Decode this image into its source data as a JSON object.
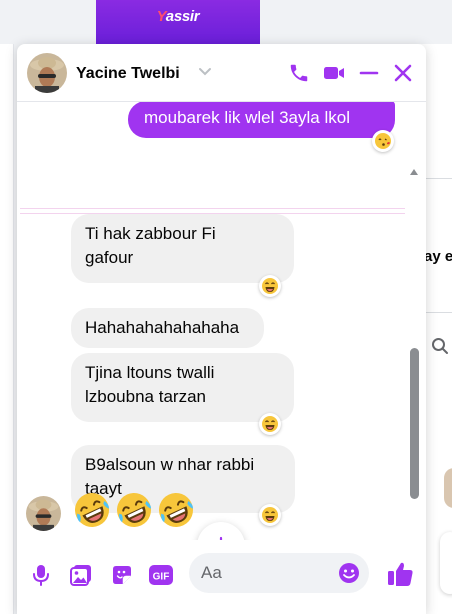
{
  "background": {
    "banner_brand": "assir",
    "banner_brand_initial": "Y",
    "side_text": "ay e"
  },
  "header": {
    "contact_name": "Yacine Twelbi"
  },
  "messages": [
    {
      "id": "m1",
      "direction": "out",
      "text": "moubarek lik wlel 3ayla lkol",
      "reaction": "kiss-emoji"
    },
    {
      "id": "m2",
      "direction": "in",
      "text": "Ti hak zabbour Fi gafour",
      "line1": "Ti hak zabbour Fi",
      "line2": "gafour",
      "reaction": "laugh-emoji"
    },
    {
      "id": "m3",
      "direction": "in",
      "text": "Hahahahahahahaha"
    },
    {
      "id": "m4",
      "direction": "in",
      "text": "Tjina ltouns twalli lzboubna tarzan",
      "line1": "Tjina ltouns twalli",
      "line2": "lzboubna tarzan",
      "reaction": "laugh-emoji"
    },
    {
      "id": "m5",
      "direction": "in",
      "text": "B9alsoun w nhar rabbi taayt",
      "line1": "B9alsoun w nhar rabbi",
      "line2": "taayt",
      "reaction": "laugh-emoji"
    }
  ],
  "last_message_emojis": [
    "rofl-emoji",
    "rofl-emoji",
    "rofl-emoji"
  ],
  "composer": {
    "placeholder": "Aa",
    "gif_label": "GIF"
  },
  "colors": {
    "accent": "#a034f0",
    "bubble_in": "#f0f0f0",
    "brand_banner": "#8a2be2"
  }
}
